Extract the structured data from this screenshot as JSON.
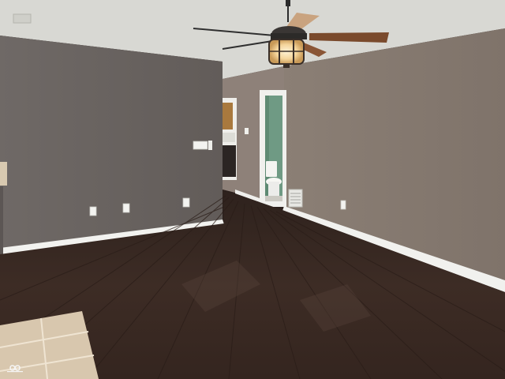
{
  "scene": {
    "description_tags": [
      "empty-room",
      "ceiling-fan",
      "hardwood-floor",
      "bathroom-doorway",
      "kitchen-glimpse"
    ],
    "colors": {
      "ceiling": "#d9d9d4",
      "wall_left": "#6b6562",
      "wall_right": "#857970",
      "wall_back": "#8d8078",
      "floor": "#3a2a24",
      "floor_plank_line": "#2a1d18",
      "baseboard": "#f2f2ef",
      "tile": "#d9c8b0",
      "tile_grout": "#efe4d2",
      "bath_wall": "#6f9a84",
      "fan_blade": "#7a4a2c",
      "fan_light": "#f4d49a",
      "cabinet": "#a9793e"
    }
  },
  "watermark": {
    "icon": "infinity-logo-icon",
    "text": ""
  }
}
